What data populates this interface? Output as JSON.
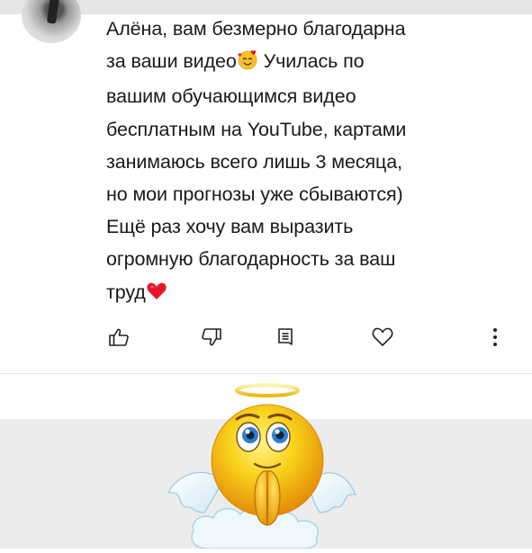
{
  "comment": {
    "lines": [
      "Алёна, вам безмерно благодарна",
      "за ваши видео",
      "Училась по",
      "вашим обучающимся видео",
      "бесплатным на YouTube, картами",
      "занимаюсь всего лишь 3 месяца,",
      "но мои прогнозы уже сбываются)",
      "Ещё раз хочу вам выразить",
      "огромную благодарность за ваш",
      "труд"
    ]
  },
  "actions": {
    "like": "like-icon",
    "dislike": "dislike-icon",
    "reply": "reply-icon",
    "heart": "heart-icon",
    "more": "more-vertical-icon"
  },
  "colors": {
    "text": "#1a1a1a",
    "heart": "#e8162b",
    "emoji_yellow": "#f7c51e",
    "lower_bg": "#ececec"
  }
}
